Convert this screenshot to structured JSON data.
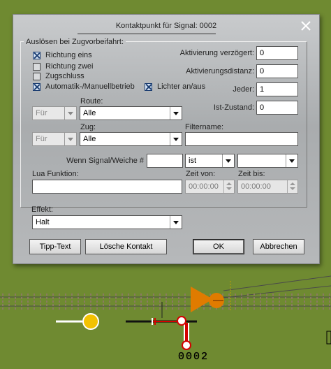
{
  "dialog": {
    "title": "Kontaktpunkt für Signal: 0002",
    "close_icon": "close-icon",
    "group_legend": "Auslösen bei Zugvorbeifahrt:",
    "checkboxes": [
      {
        "label": "Richtung eins",
        "checked": true
      },
      {
        "label": "Richtung zwei",
        "checked": false
      },
      {
        "label": "Zugschluss",
        "checked": false
      },
      {
        "label": "Automatik-/Manuellbetrieb",
        "checked": true
      },
      {
        "label": "Lichter an/aus",
        "checked": true
      }
    ],
    "aktivierung_verzoegert": {
      "label": "Aktivierung verzögert:",
      "value": "0"
    },
    "aktivierungsdistanz": {
      "label": "Aktivierungsdistanz:",
      "value": "0"
    },
    "jeder": {
      "label": "Jeder:",
      "value": "1"
    },
    "ist_zustand": {
      "label": "Ist-Zustand:",
      "value": "0"
    },
    "route": {
      "label": "Route:",
      "qualifier": "Für",
      "value": "Alle"
    },
    "zug": {
      "label": "Zug:",
      "qualifier": "Für",
      "value": "Alle"
    },
    "filtername": {
      "label": "Filtername:",
      "value": ""
    },
    "wenn_signal": {
      "label": "Wenn Signal/Weiche #",
      "value": "",
      "operator": "ist",
      "state": ""
    },
    "lua_funktion": {
      "label": "Lua Funktion:",
      "value": ""
    },
    "zeit_von": {
      "label": "Zeit von:",
      "value": "00:00:00"
    },
    "zeit_bis": {
      "label": "Zeit bis:",
      "value": "00:00:00"
    },
    "effekt": {
      "label": "Effekt:",
      "value": "Halt"
    },
    "buttons": {
      "tipp_text": "Tipp-Text",
      "loesche_kontakt": "Lösche Kontakt",
      "ok": "OK",
      "abbrechen": "Abbrechen"
    }
  },
  "scene": {
    "signal_label": "0002",
    "background_color": "#6f8a31",
    "signal_lamp_color": "#f2c200",
    "contact_marker_color": "#e07b00",
    "signal_red": "#d40000"
  }
}
